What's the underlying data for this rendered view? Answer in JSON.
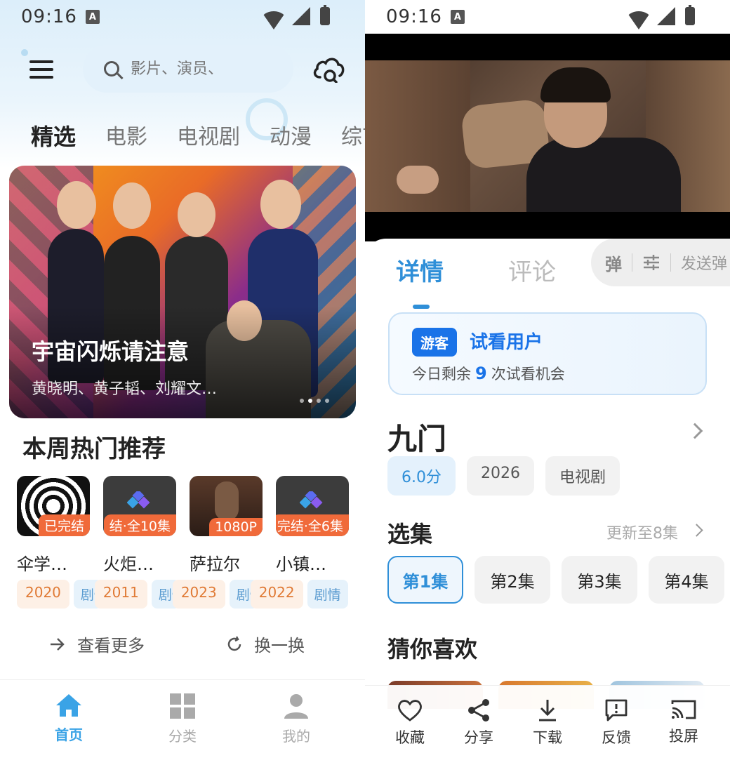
{
  "status": {
    "time": "09:16",
    "badge": "A"
  },
  "left": {
    "search": {
      "placeholder": "影片、演员、"
    },
    "categories": [
      {
        "label": "精选",
        "active": true
      },
      {
        "label": "电影"
      },
      {
        "label": "电视剧"
      },
      {
        "label": "动漫"
      },
      {
        "label": "综艺"
      }
    ],
    "banner": {
      "title": "宇宙闪烁请注意",
      "subtitle": "黄晓明、黄子韬、刘耀文…",
      "page_count": 4,
      "active_page": 2
    },
    "hot": {
      "title": "本周热门推荐",
      "items": [
        {
          "name": "伞学…",
          "badge": "已完结",
          "year": "2020"
        },
        {
          "name": "火炬…",
          "badge": "结·全10集",
          "genre": "剧情",
          "year": "2011"
        },
        {
          "name": "萨拉尔",
          "badge": "1080P",
          "genre": "剧情",
          "year": "2023"
        },
        {
          "name": "小镇…",
          "badge": "完结·全6集",
          "genre": "剧情",
          "year": "2022"
        },
        {
          "genre": "剧情"
        }
      ]
    },
    "more_label": "查看更多",
    "shuffle_label": "换一换",
    "nav": [
      {
        "label": "首页",
        "active": true
      },
      {
        "label": "分类"
      },
      {
        "label": "我的"
      }
    ]
  },
  "right": {
    "tabs": [
      {
        "label": "详情",
        "active": true
      },
      {
        "label": "评论"
      }
    ],
    "danmu": {
      "label": "弹",
      "send_placeholder": "发送弹"
    },
    "guest": {
      "badge": "游客",
      "title": "试看用户",
      "sub_prefix": "今日剩余",
      "remaining": "9",
      "sub_suffix": "次试看机会"
    },
    "show": {
      "title": "九门",
      "score": "6.0分",
      "year": "2026",
      "type": "电视剧"
    },
    "episodes": {
      "title": "选集",
      "update": "更新至8集",
      "list": [
        "第1集",
        "第2集",
        "第3集",
        "第4集"
      ],
      "active_index": 0
    },
    "guess_title": "猜你喜欢",
    "actions": [
      "收藏",
      "分享",
      "下载",
      "反馈",
      "投屏"
    ]
  },
  "colors": {
    "accent": "#2f8fd8",
    "nav_active": "#3aa3e6",
    "badge_orange": "#f06a3a",
    "guest_blue": "#1a73e8"
  }
}
